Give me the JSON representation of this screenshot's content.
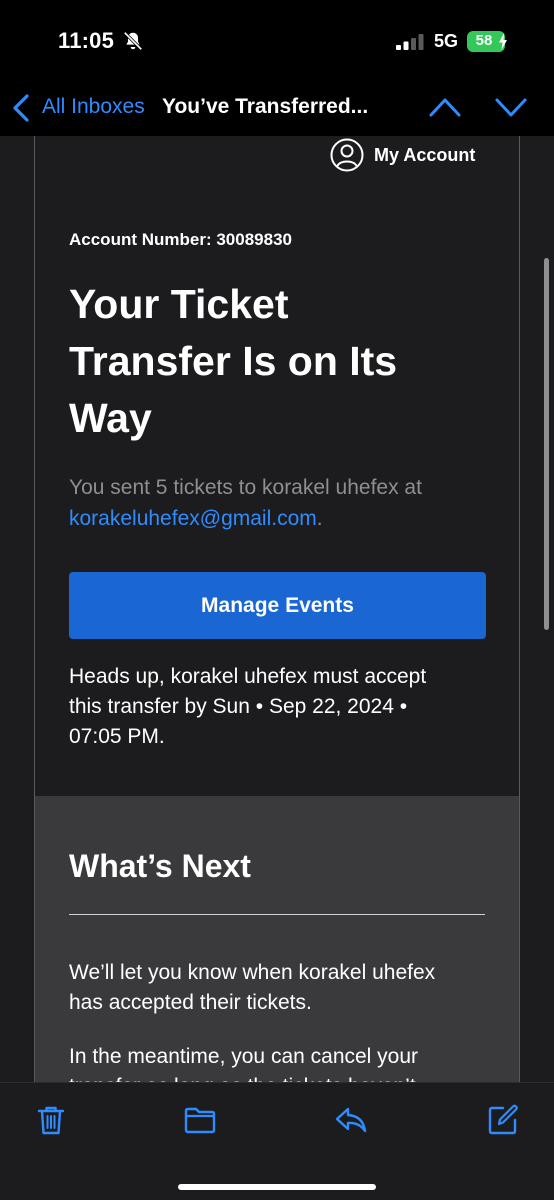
{
  "status_bar": {
    "time": "11:05",
    "network": "5G",
    "battery": "58"
  },
  "mail_nav": {
    "back_label": "All Inboxes",
    "subject": "You’ve Transferred..."
  },
  "email": {
    "account_link": "My Account",
    "account_number": "Account Number: 30089830",
    "headline_lines": [
      "Your Ticket",
      "Transfer Is on Its",
      "Way"
    ],
    "sent_text": "You sent 5 tickets to korakel uhefex at",
    "recipient_email": "korakeluhefex@gmail.com",
    "sent_suffix": ".",
    "manage_button": "Manage Events",
    "headsup_lines": [
      "Heads up, korakel uhefex must accept",
      "this transfer by Sun • Sep 22, 2024 •",
      "07:05 PM."
    ],
    "next_title": "What’s Next",
    "next_p1_lines": [
      "We’ll let you know when korakel uhefex",
      "has accepted their tickets."
    ],
    "next_p2_lines": [
      "In the meantime, you can cancel your",
      "transfer as long as the tickets haven’t"
    ]
  },
  "colors": {
    "accent": "#2f8cff",
    "button": "#1a66d2",
    "battery": "#34c759"
  }
}
